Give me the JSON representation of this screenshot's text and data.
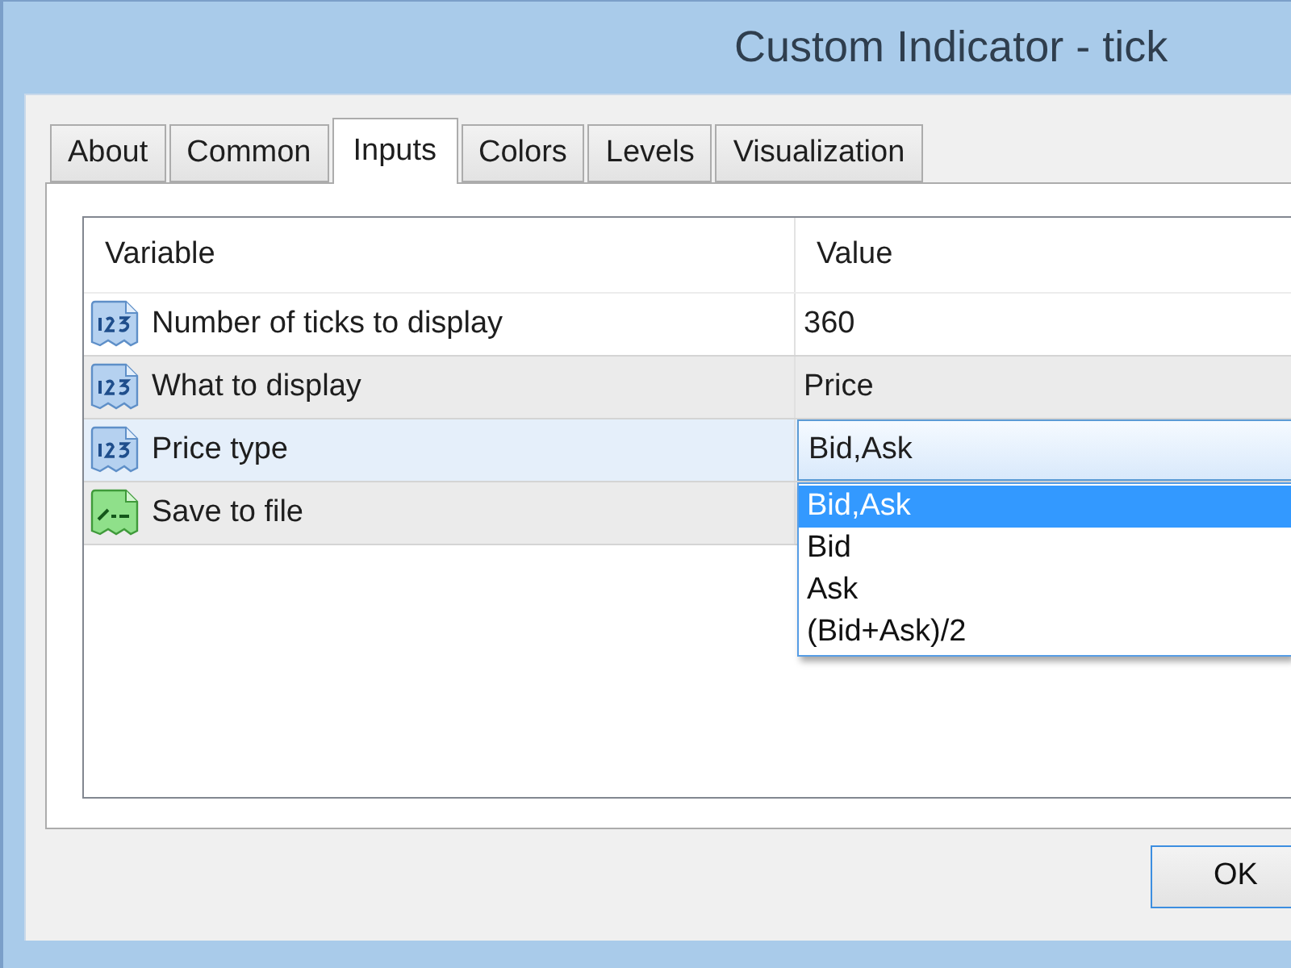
{
  "window": {
    "title": "Custom Indicator - tick"
  },
  "tabs": [
    {
      "label": "About",
      "selected": false
    },
    {
      "label": "Common",
      "selected": false
    },
    {
      "label": "Inputs",
      "selected": true
    },
    {
      "label": "Colors",
      "selected": false
    },
    {
      "label": "Levels",
      "selected": false
    },
    {
      "label": "Visualization",
      "selected": false
    }
  ],
  "inputs_table": {
    "columns": [
      "Variable",
      "Value"
    ],
    "rows": [
      {
        "kind": "number",
        "variable": "Number of ticks to display",
        "value": "360",
        "selected": false
      },
      {
        "kind": "number",
        "variable": "What to display",
        "value": "Price",
        "selected": false
      },
      {
        "kind": "number",
        "variable": "Price type",
        "value": "Bid,Ask",
        "selected": true,
        "expanded": true,
        "options": [
          {
            "label": "Bid,Ask",
            "selected": true
          },
          {
            "label": "Bid",
            "selected": false
          },
          {
            "label": "Ask",
            "selected": false
          },
          {
            "label": "(Bid+Ask)/2",
            "selected": false
          }
        ]
      },
      {
        "kind": "boolean",
        "variable": "Save to file",
        "selected": false
      }
    ]
  },
  "buttons": [
    {
      "label": "OK",
      "default": true
    }
  ]
}
